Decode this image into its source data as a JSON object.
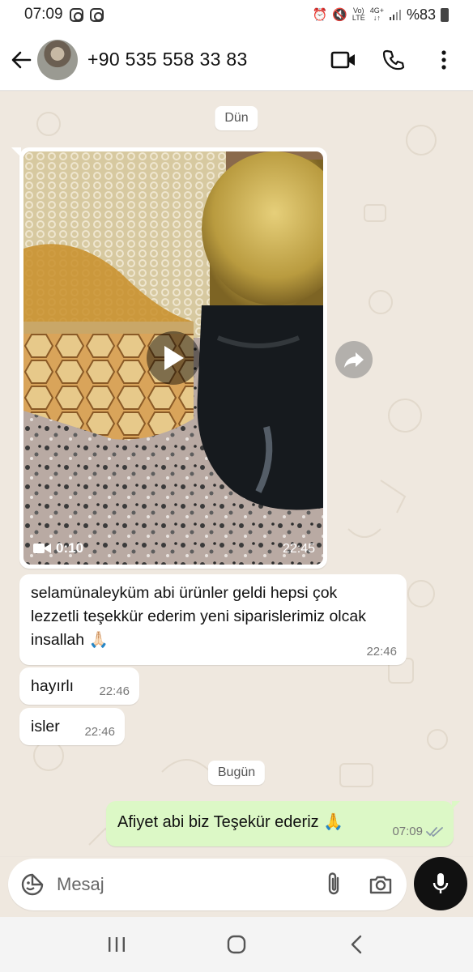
{
  "status_bar": {
    "time": "07:09",
    "network_top": "Vo)",
    "network_bottom": "LTE",
    "data_top": "4G+",
    "data_bottom": "↓↑",
    "battery": "%83"
  },
  "header": {
    "contact": "+90 535 558 33 83"
  },
  "chat": {
    "date_yesterday": "Dün",
    "date_today": "Bugün",
    "video": {
      "duration": "0:10",
      "time": "22:45"
    },
    "messages": [
      {
        "text": "selamünaleyküm abi ürünler geldi hepsi çok lezzetli teşekkür ederim yeni siparislerimiz olcak insallah 🙏🏻",
        "time": "22:46",
        "direction": "in"
      },
      {
        "text": "hayırlı",
        "time": "22:46",
        "direction": "in"
      },
      {
        "text": "isler",
        "time": "22:46",
        "direction": "in"
      },
      {
        "text": "Afiyet abi biz Teşekür ederiz 🙏",
        "time": "07:09",
        "direction": "out",
        "read": true
      }
    ]
  },
  "composer": {
    "placeholder": "Mesaj"
  },
  "colors": {
    "outgoing_bubble": "#dcf8c6",
    "incoming_bubble": "#ffffff",
    "chat_background": "#efe8df",
    "read_ticks": "#8a9aa8"
  }
}
